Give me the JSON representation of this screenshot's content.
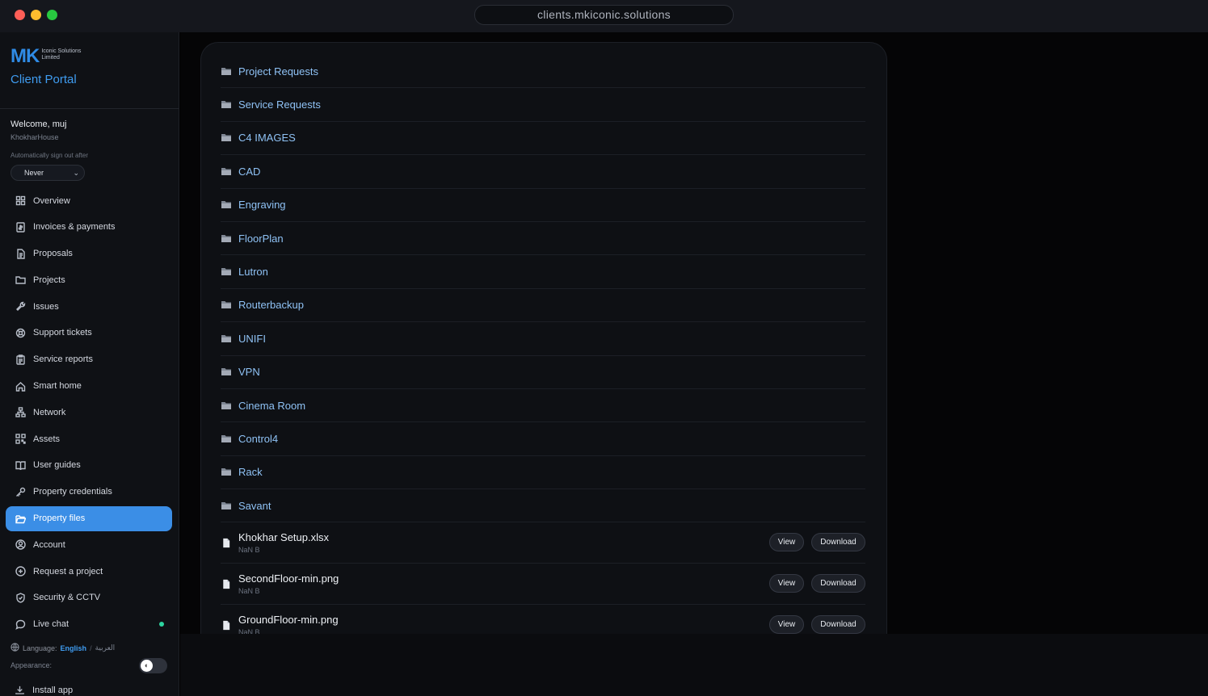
{
  "browser": {
    "url": "clients.mkiconic.solutions"
  },
  "brand": {
    "logo_letters": "MK",
    "logo_text": "Iconic Solutions Limited",
    "portal_title": "Client Portal"
  },
  "user": {
    "welcome": "Welcome, muj",
    "property": "KhokharHouse",
    "auto_signout_label": "Automatically sign out after",
    "auto_signout_value": "Never"
  },
  "nav": [
    {
      "label": "Overview",
      "icon": "grid-icon"
    },
    {
      "label": "Invoices & payments",
      "icon": "invoice-icon"
    },
    {
      "label": "Proposals",
      "icon": "document-icon"
    },
    {
      "label": "Projects",
      "icon": "folder-icon"
    },
    {
      "label": "Issues",
      "icon": "wrench-icon"
    },
    {
      "label": "Support tickets",
      "icon": "lifebuoy-icon"
    },
    {
      "label": "Service reports",
      "icon": "clipboard-icon"
    },
    {
      "label": "Smart home",
      "icon": "home-icon"
    },
    {
      "label": "Network",
      "icon": "network-icon"
    },
    {
      "label": "Assets",
      "icon": "qr-icon"
    },
    {
      "label": "User guides",
      "icon": "book-icon"
    },
    {
      "label": "Property credentials",
      "icon": "key-icon"
    },
    {
      "label": "Property files",
      "icon": "folder-open-icon",
      "active": true
    },
    {
      "label": "Account",
      "icon": "user-circle-icon"
    },
    {
      "label": "Request a project",
      "icon": "plus-circle-icon"
    },
    {
      "label": "Security & CCTV",
      "icon": "shield-icon"
    },
    {
      "label": "Live chat",
      "icon": "chat-icon",
      "status_dot": true
    }
  ],
  "footer": {
    "language_label": "Language:",
    "language_en": "English",
    "language_sep": "/",
    "language_ar": "العربية",
    "appearance_label": "Appearance:",
    "install_label": "Install app"
  },
  "folders": [
    "Project Requests",
    "Service Requests",
    "C4 IMAGES",
    "CAD",
    "Engraving",
    "FloorPlan",
    "Lutron",
    "Routerbackup",
    "UNIFI",
    "VPN",
    "Cinema Room",
    "Control4",
    "Rack",
    "Savant"
  ],
  "files": [
    {
      "name": "Khokhar Setup.xlsx",
      "size": "NaN B"
    },
    {
      "name": "SecondFloor-min.png",
      "size": "NaN B"
    },
    {
      "name": "GroundFloor-min.png",
      "size": "NaN B"
    }
  ],
  "file_actions": {
    "view": "View",
    "download": "Download"
  },
  "colors": {
    "accent": "#3b8ee6",
    "folder_text": "#8fc2f5",
    "live_dot": "#2dd4a0"
  }
}
